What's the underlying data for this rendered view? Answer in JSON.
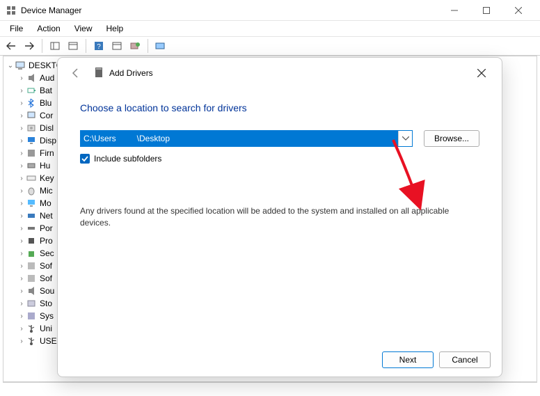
{
  "window": {
    "title": "Device Manager"
  },
  "menubar": {
    "items": [
      "File",
      "Action",
      "View",
      "Help"
    ]
  },
  "tree": {
    "root": "DESKTO",
    "items": [
      {
        "label": "Aud",
        "icon": "speaker"
      },
      {
        "label": "Bat",
        "icon": "battery"
      },
      {
        "label": "Blu",
        "icon": "bluetooth"
      },
      {
        "label": "Cor",
        "icon": "computer"
      },
      {
        "label": "Disl",
        "icon": "disk"
      },
      {
        "label": "Disp",
        "icon": "display"
      },
      {
        "label": "Firn",
        "icon": "firmware"
      },
      {
        "label": "Hu",
        "icon": "hid"
      },
      {
        "label": "Key",
        "icon": "keyboard"
      },
      {
        "label": "Mic",
        "icon": "mouse"
      },
      {
        "label": "Mo",
        "icon": "monitor"
      },
      {
        "label": "Net",
        "icon": "network"
      },
      {
        "label": "Por",
        "icon": "port"
      },
      {
        "label": "Pro",
        "icon": "processor"
      },
      {
        "label": "Sec",
        "icon": "security"
      },
      {
        "label": "Sof",
        "icon": "software"
      },
      {
        "label": "Sof",
        "icon": "software"
      },
      {
        "label": "Sou",
        "icon": "sound"
      },
      {
        "label": "Sto",
        "icon": "storage"
      },
      {
        "label": "Sys",
        "icon": "system"
      },
      {
        "label": "Uni",
        "icon": "usb"
      },
      {
        "label": "USE",
        "icon": "usb"
      }
    ]
  },
  "dialog": {
    "title": "Add Drivers",
    "heading": "Choose a location to search for drivers",
    "path_value": "C:\\Users         \\Desktop",
    "browse_label": "Browse...",
    "include_subfolders_label": "Include subfolders",
    "include_subfolders_checked": true,
    "description": "Any drivers found at the specified location will be added to the system and installed on all applicable devices.",
    "next_label": "Next",
    "cancel_label": "Cancel"
  }
}
